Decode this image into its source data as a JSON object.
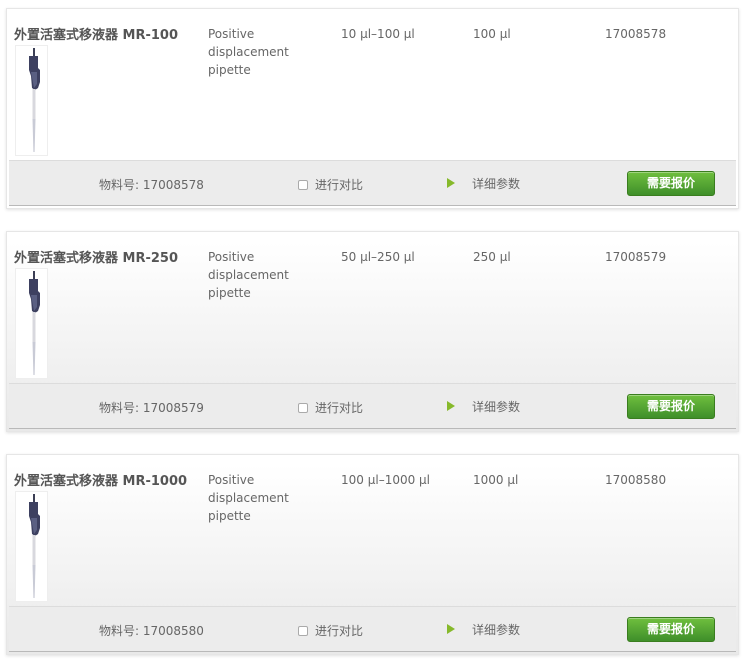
{
  "products": [
    {
      "name": "外置活塞式移液器 MR-100",
      "type_line1": "Positive displacement",
      "type_line2": "pipette",
      "volume_range": "10 µl–100 µl",
      "increment": "100 µl",
      "part_number": "17008578",
      "material_label": "物料号: 17008578",
      "compare_label": "进行对比",
      "details_label": "详细参数",
      "quote_label": "需要报价"
    },
    {
      "name": "外置活塞式移液器 MR-250",
      "type_line1": "Positive displacement",
      "type_line2": "pipette",
      "volume_range": "50 µl–250 µl",
      "increment": "250 µl",
      "part_number": "17008579",
      "material_label": "物料号: 17008579",
      "compare_label": "进行对比",
      "details_label": "详细参数",
      "quote_label": "需要报价"
    },
    {
      "name": "外置活塞式移液器 MR-1000",
      "type_line1": "Positive displacement",
      "type_line2": "pipette",
      "volume_range": "100 µl–1000 µl",
      "increment": "1000 µl",
      "part_number": "17008580",
      "material_label": "物料号: 17008580",
      "compare_label": "进行对比",
      "details_label": "详细参数",
      "quote_label": "需要报价"
    }
  ],
  "icons": {
    "details_arrow": "play-arrow-icon",
    "thumbnail": "pipette-image"
  },
  "colors": {
    "quote_button": "#4f9e30",
    "details_arrow": "#86b92b"
  }
}
